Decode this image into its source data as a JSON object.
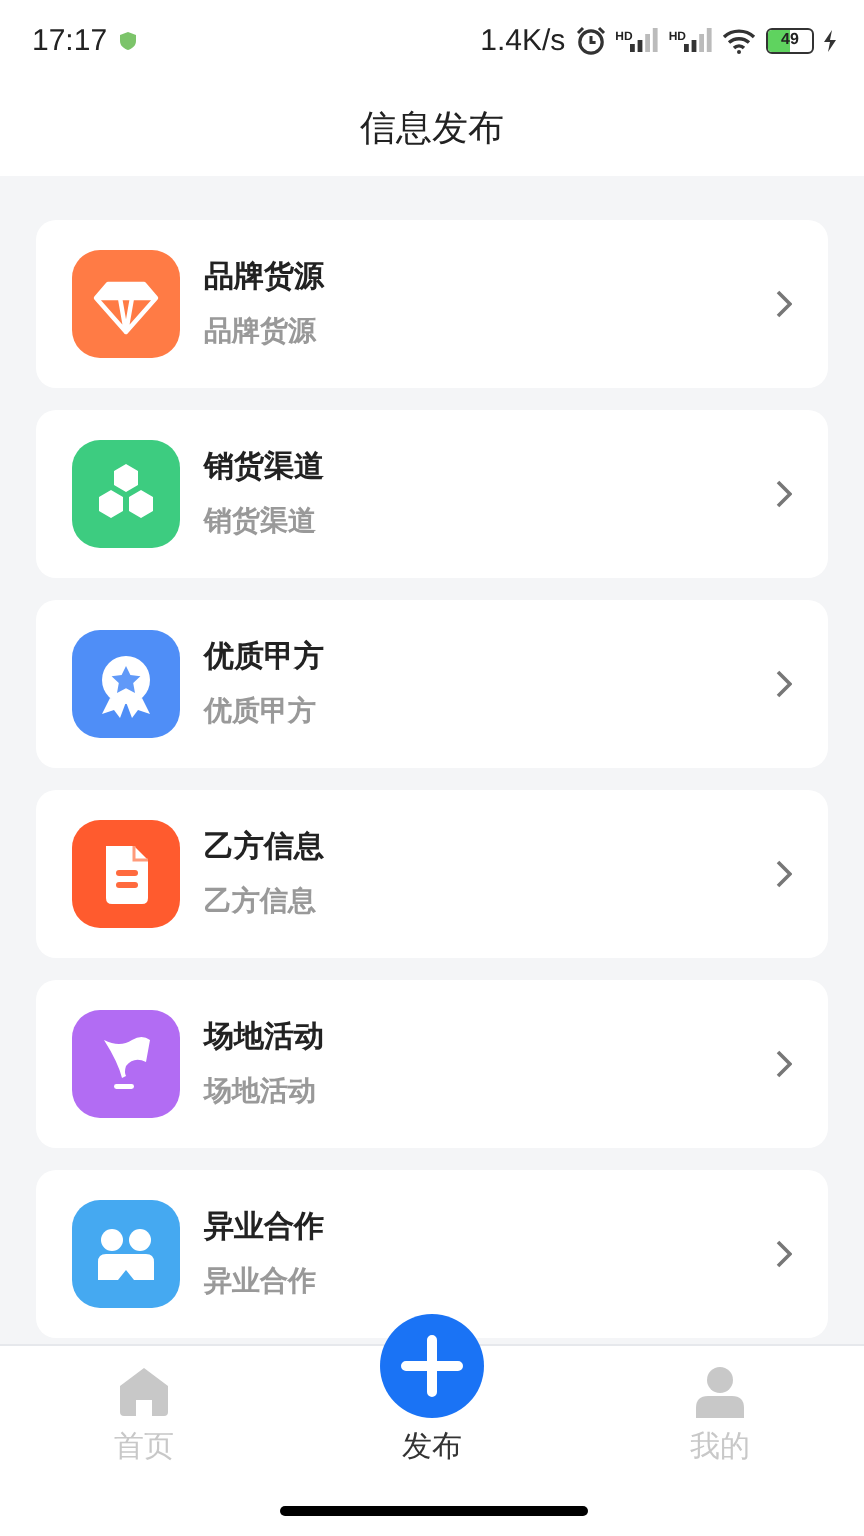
{
  "status_bar": {
    "time": "17:17",
    "net_speed": "1.4K/s",
    "signal_labels": [
      "HD",
      "HD"
    ],
    "battery": "49"
  },
  "header": {
    "title": "信息发布"
  },
  "items": [
    {
      "kind": "diamond",
      "color": "#ff7b45",
      "title": "品牌货源",
      "subtitle": "品牌货源"
    },
    {
      "kind": "hexagons",
      "color": "#3dcc80",
      "title": "销货渠道",
      "subtitle": "销货渠道"
    },
    {
      "kind": "badge",
      "color": "#4f8ef7",
      "title": "优质甲方",
      "subtitle": "优质甲方"
    },
    {
      "kind": "document",
      "color": "#ff5b2e",
      "title": "乙方信息",
      "subtitle": "乙方信息"
    },
    {
      "kind": "flag",
      "color": "#b26cf3",
      "title": "场地活动",
      "subtitle": "场地活动"
    },
    {
      "kind": "people",
      "color": "#45a9f1",
      "title": "异业合作",
      "subtitle": "异业合作"
    }
  ],
  "tabs": [
    {
      "kind": "home",
      "label": "首页",
      "selected": false
    },
    {
      "kind": "plus",
      "label": "发布",
      "selected": true
    },
    {
      "kind": "person",
      "label": "我的",
      "selected": false
    }
  ]
}
